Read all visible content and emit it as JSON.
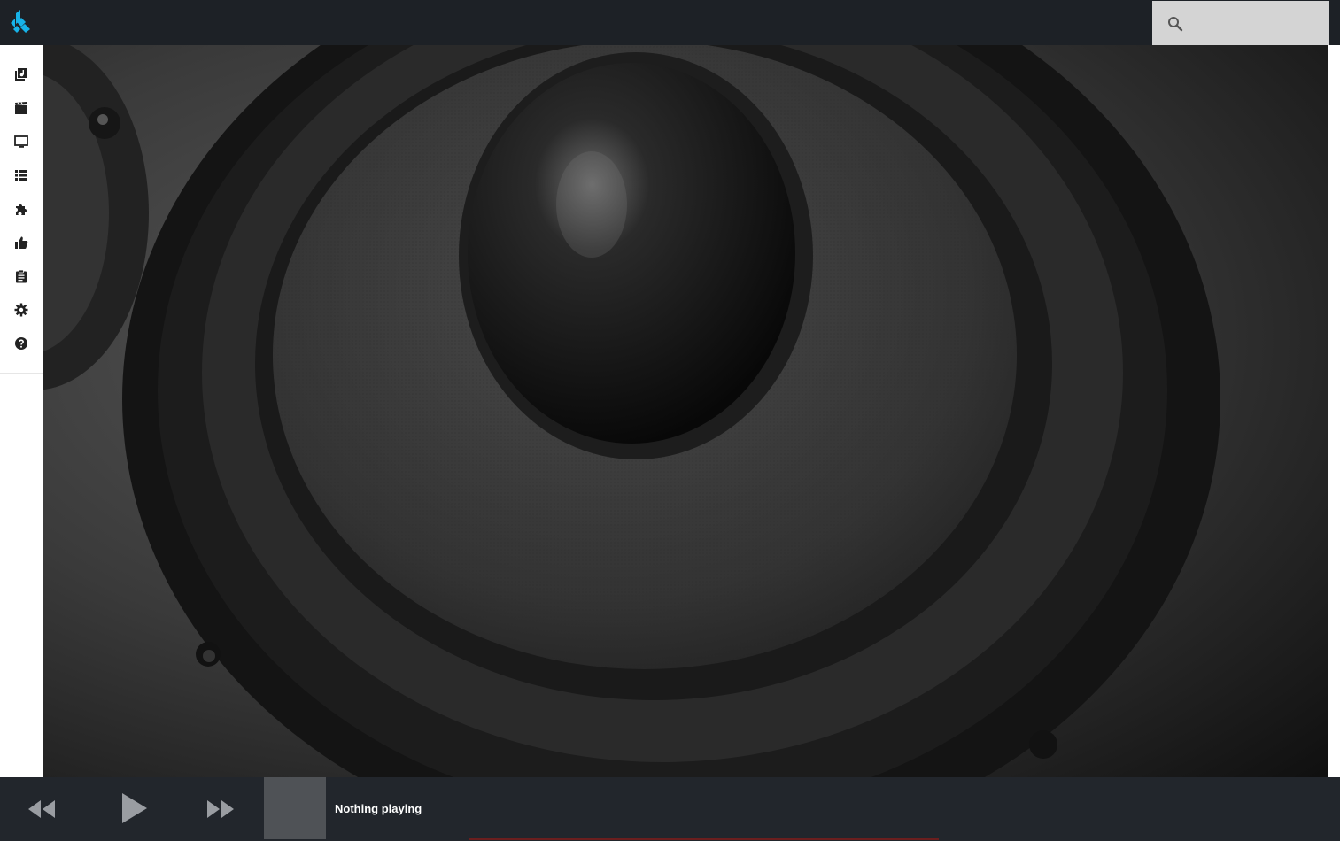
{
  "header": {
    "logo_icon": "kodi-logo-icon",
    "search": {
      "placeholder": "",
      "value": "",
      "icon": "search-icon"
    }
  },
  "sidebar": {
    "items": [
      {
        "icon": "music-library-icon"
      },
      {
        "icon": "movies-icon"
      },
      {
        "icon": "tv-shows-icon"
      },
      {
        "icon": "playlist-icon"
      },
      {
        "icon": "addons-icon"
      },
      {
        "icon": "thumbs-up-icon"
      },
      {
        "icon": "clipboard-icon"
      },
      {
        "icon": "settings-icon"
      },
      {
        "icon": "help-icon"
      }
    ]
  },
  "player": {
    "status": "Nothing playing",
    "controls": [
      "rewind-icon",
      "play-icon",
      "fast-forward-icon"
    ]
  },
  "colors": {
    "topbar": "#1d2126",
    "sidebar": "#ffffff",
    "search_bg": "#d4d4d4",
    "player_bg": "#22262c",
    "kodi_blue": "#17b2e7"
  }
}
